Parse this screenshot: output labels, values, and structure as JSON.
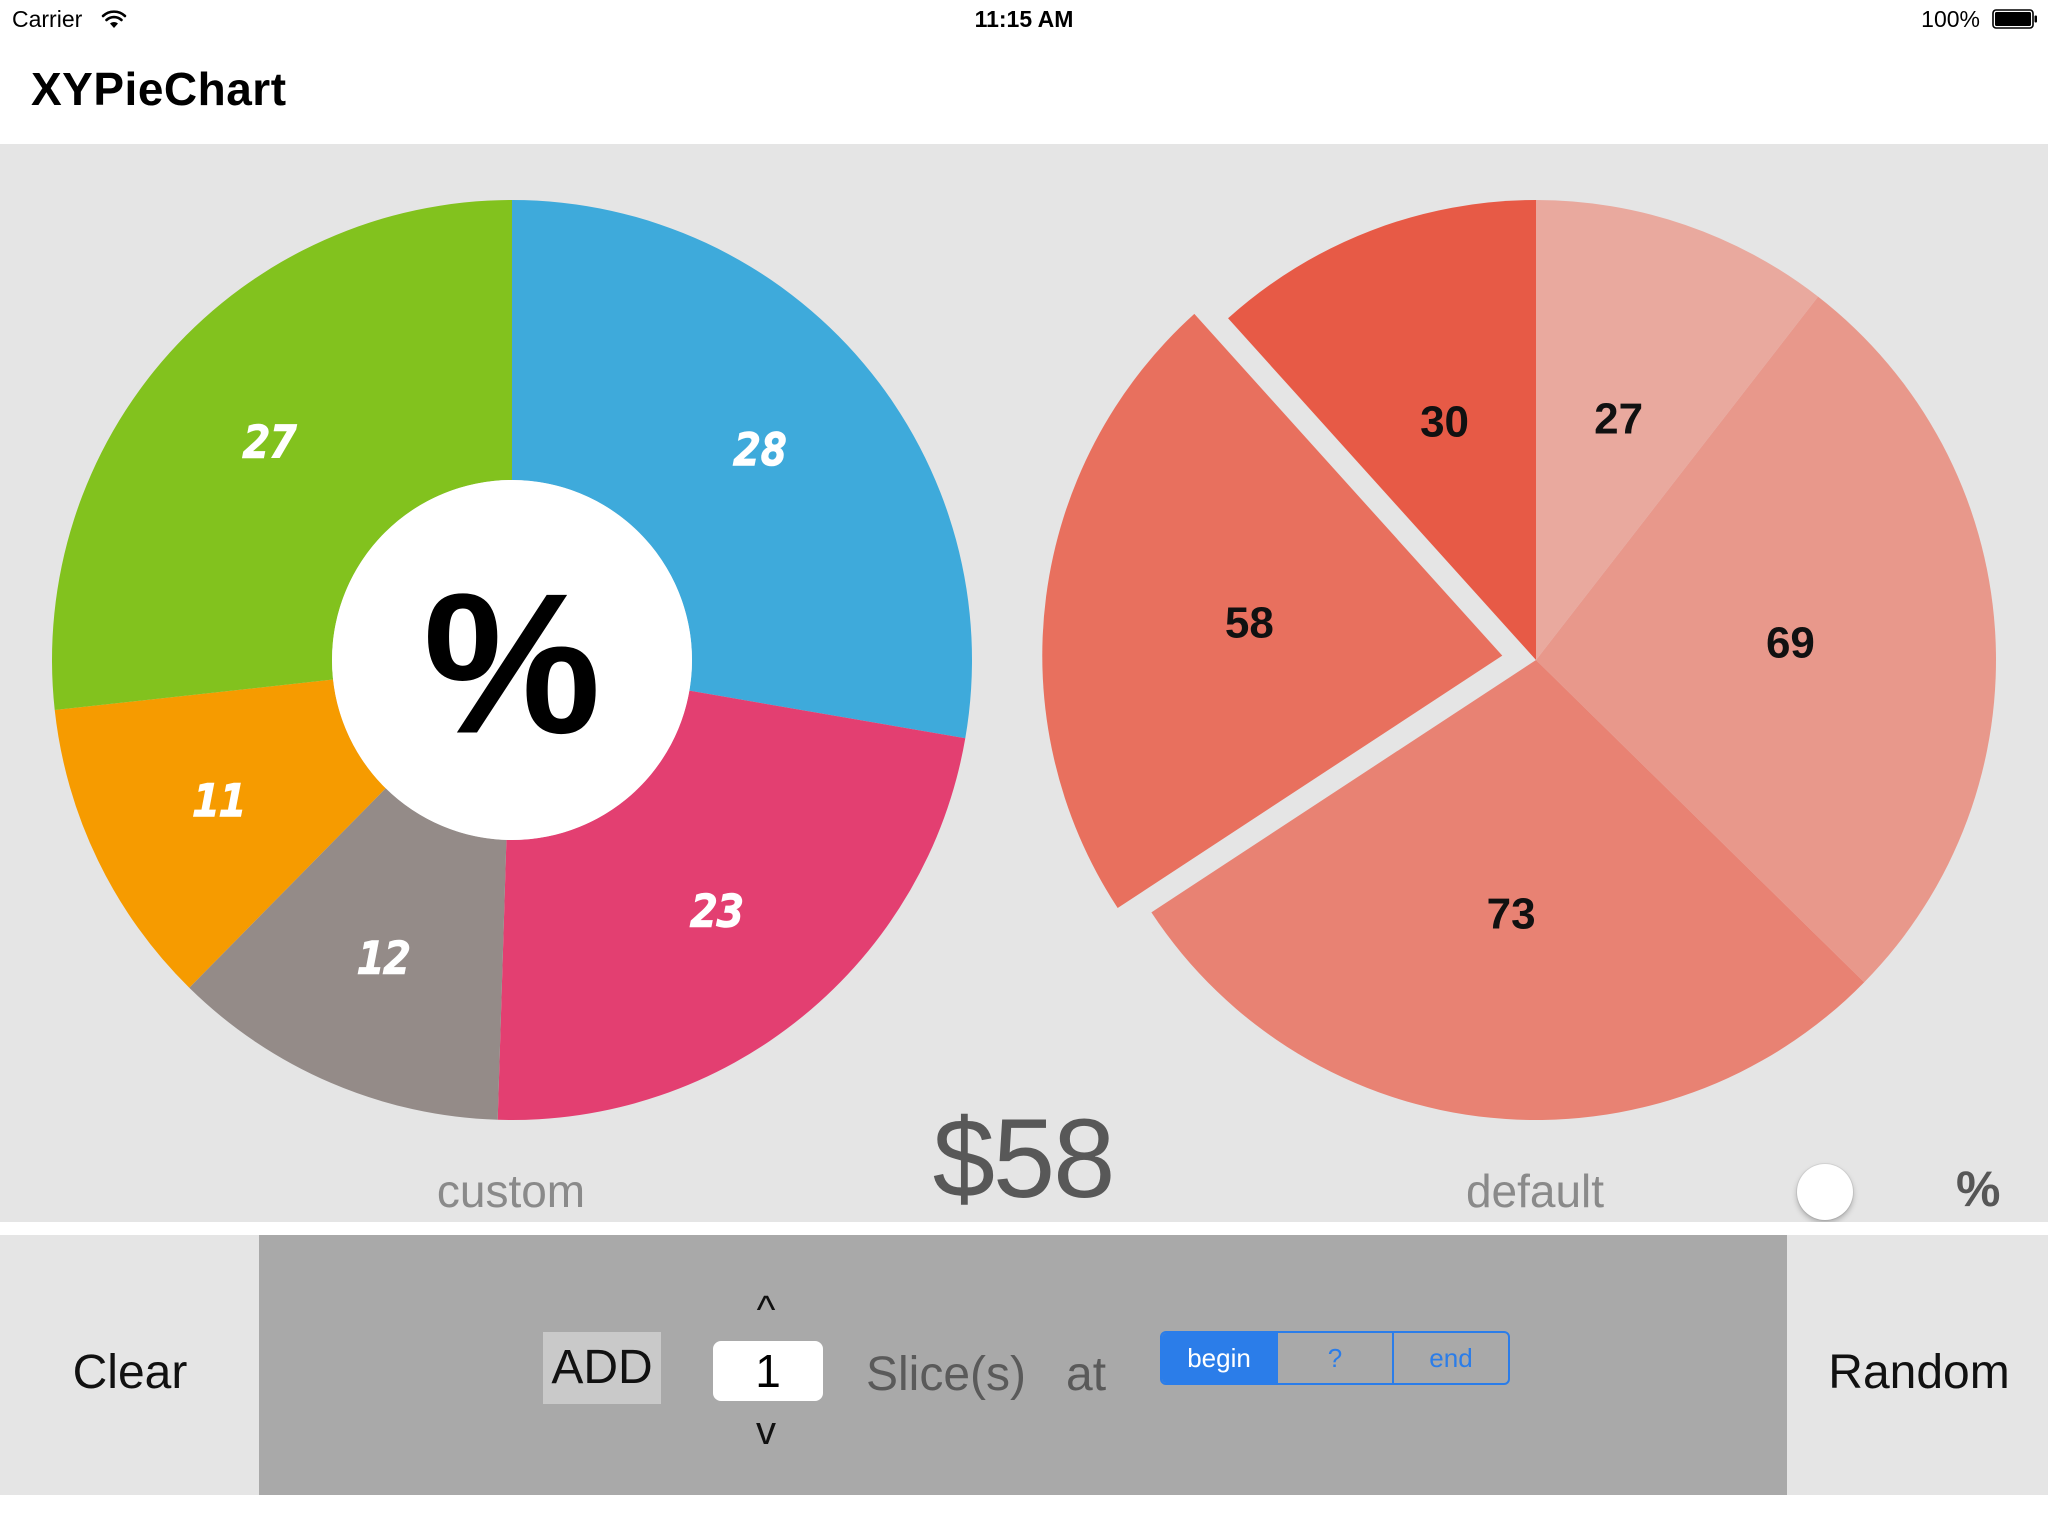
{
  "status_bar": {
    "carrier": "Carrier",
    "time": "11:15 AM",
    "battery": "100%"
  },
  "nav": {
    "title": "XYPieChart"
  },
  "custom_chart": {
    "caption": "custom",
    "center_label": "%",
    "slices": [
      {
        "label": "28",
        "color": "#3eaadb"
      },
      {
        "label": "23",
        "color": "#e33f71"
      },
      {
        "label": "12",
        "color": "#948b88"
      },
      {
        "label": "11",
        "color": "#f69b00"
      },
      {
        "label": "27",
        "color": "#82c21e"
      }
    ]
  },
  "default_chart": {
    "caption": "default",
    "slices": [
      {
        "label": "27",
        "color": "#e9a99e"
      },
      {
        "label": "69",
        "color": "#e8988b"
      },
      {
        "label": "73",
        "color": "#e88273"
      },
      {
        "label": "58",
        "color": "#e8705e"
      },
      {
        "label": "30",
        "color": "#e75a46"
      }
    ]
  },
  "selected_value": "$58",
  "percent_toggle_label": "%",
  "toolbar": {
    "clear_label": "Clear",
    "random_label": "Random",
    "add_label": "ADD",
    "stepper_up": "^",
    "stepper_down": "v",
    "count_value": "1",
    "slices_label": "Slice(s)",
    "at_label": "at",
    "position_options": [
      "begin",
      "?",
      "end"
    ],
    "selected_position": "begin"
  }
}
